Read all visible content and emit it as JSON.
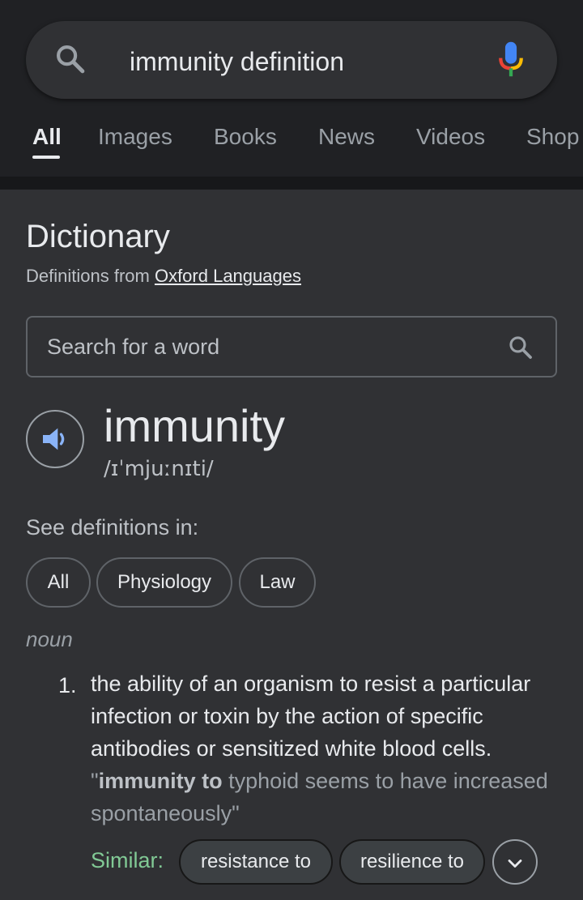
{
  "search": {
    "query": "immunity definition"
  },
  "tabs": [
    {
      "label": "All",
      "active": true
    },
    {
      "label": "Images"
    },
    {
      "label": "Books"
    },
    {
      "label": "News"
    },
    {
      "label": "Videos"
    },
    {
      "label": "Shop"
    }
  ],
  "dictionary": {
    "title": "Dictionary",
    "source_prefix": "Definitions from ",
    "source_link": "Oxford Languages",
    "word_search_placeholder": "Search for a word",
    "headword": "immunity",
    "phonetic": "/ɪˈmjuːnɪti/",
    "see_definitions_label": "See definitions in:",
    "filter_chips": [
      "All",
      "Physiology",
      "Law"
    ],
    "part_of_speech": "noun",
    "definitions": [
      {
        "number": "1.",
        "text": "the ability of an organism to resist a particular infection or toxin by the action of specific antibodies or sensitized white blood cells.",
        "example_quote_open": "\"",
        "example_bold": "immunity to",
        "example_rest": " typhoid seems to have increased spontaneously\"",
        "similar_label": "Similar:",
        "similar": [
          "resistance to",
          "resilience to"
        ]
      }
    ]
  },
  "colors": {
    "page_bg": "#303134",
    "header_bg": "#202124",
    "similar_label": "#81c995",
    "speaker_blue": "#8ab4f8"
  },
  "icons": [
    "search-icon",
    "mic-icon",
    "speaker-icon",
    "chevron-down-icon"
  ]
}
